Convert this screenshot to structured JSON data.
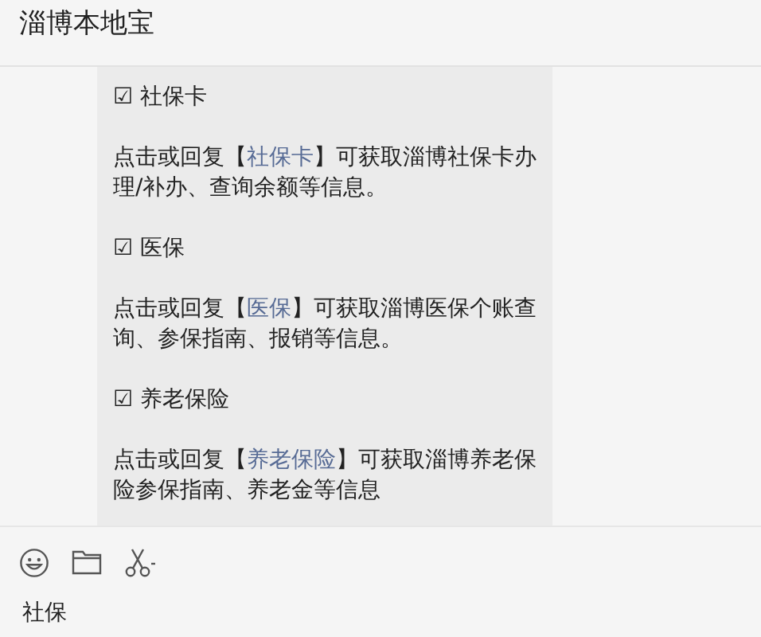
{
  "header": {
    "title": "淄博本地宝"
  },
  "messages": [
    {
      "title": "☑ 社保卡",
      "before": "点击或回复【",
      "link": "社保卡",
      "after": "】可获取淄博社保卡办理/补办、查询余额等信息。"
    },
    {
      "title": "☑ 医保",
      "before": "点击或回复【",
      "link": "医保",
      "after": "】可获取淄博医保个账查询、参保指南、报销等信息。"
    },
    {
      "title": "☑ 养老保险",
      "before": "点击或回复【",
      "link": "养老保险",
      "after": "】可获取淄博养老保险参保指南、养老金等信息"
    }
  ],
  "composer": {
    "value": "社保"
  }
}
